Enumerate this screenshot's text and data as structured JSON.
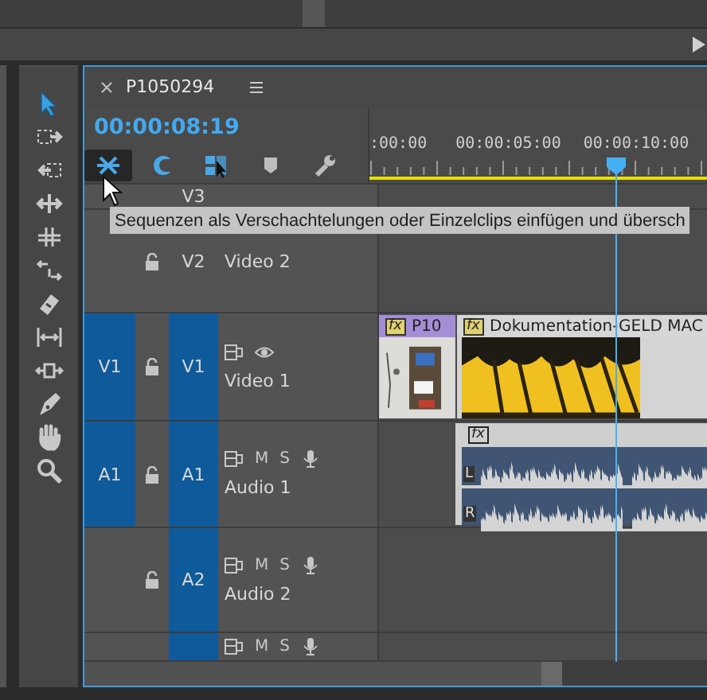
{
  "tools": [
    {
      "kind": "selection",
      "selected": true
    },
    {
      "kind": "track-select",
      "selected": false
    },
    {
      "kind": "ripple",
      "selected": false
    },
    {
      "kind": "rolling",
      "selected": false
    },
    {
      "kind": "stretch",
      "selected": false
    },
    {
      "kind": "scatter",
      "selected": false
    },
    {
      "kind": "razor",
      "selected": false
    },
    {
      "kind": "slip",
      "selected": false
    },
    {
      "kind": "slide",
      "selected": false
    },
    {
      "kind": "pen",
      "selected": false
    },
    {
      "kind": "hand",
      "selected": false
    },
    {
      "kind": "zoom",
      "selected": false
    }
  ],
  "sequence": {
    "title": "P1050294",
    "timecode": "00:00:08:19"
  },
  "toolbar": [
    {
      "kind": "nest",
      "on": true
    },
    {
      "kind": "snap",
      "on": true
    },
    {
      "kind": "linked",
      "on": true
    },
    {
      "kind": "marker",
      "on": false
    },
    {
      "kind": "settings",
      "on": false
    }
  ],
  "ruler": {
    "labels": [
      ":00:00",
      "00:00:05:00",
      "00:00:10:00"
    ]
  },
  "tooltip": "Sequenzen als Verschachtelungen oder Einzelclips einfügen und übersch",
  "tracks": [
    {
      "kind": "video",
      "label": "V3",
      "targeted": false
    },
    {
      "kind": "video",
      "label": "V2",
      "name": "Video 2",
      "locked": false,
      "targeted": false
    },
    {
      "kind": "video",
      "source": "V1",
      "label": "V1",
      "name": "Video 1",
      "locked": false,
      "targeted": true,
      "controls": true,
      "clips": [
        {
          "kind": "video",
          "label": "P10",
          "fx": "fx",
          "color": "#a48ed6"
        },
        {
          "kind": "video",
          "label": "Dokumentation-GELD MAC",
          "fx": "fx",
          "color": "#d6d6d6"
        }
      ]
    },
    {
      "kind": "audio",
      "source": "A1",
      "label": "A1",
      "name": "Audio 1",
      "locked": false,
      "targeted": true,
      "mute": "M",
      "solo": "S",
      "clips": [
        {
          "kind": "audio",
          "fx": "fx",
          "channels": [
            "L",
            "R"
          ]
        }
      ]
    },
    {
      "kind": "audio",
      "label": "A2",
      "name": "Audio 2",
      "locked": false,
      "targeted": true,
      "mute": "M",
      "solo": "S"
    },
    {
      "kind": "audio",
      "targeted": true,
      "mute": "M",
      "solo": "S"
    }
  ]
}
